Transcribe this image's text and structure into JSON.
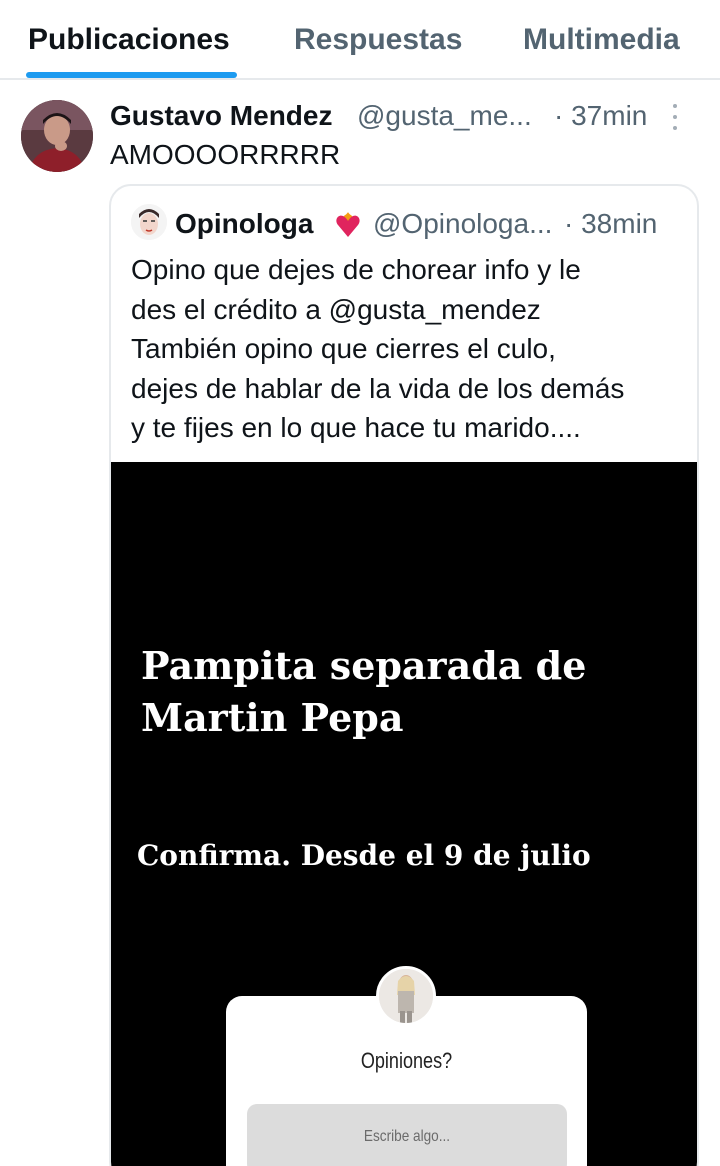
{
  "tabs": [
    {
      "label": "Publicaciones",
      "active": true
    },
    {
      "label": "Respuestas",
      "active": false
    },
    {
      "label": "Multimedia",
      "active": false
    }
  ],
  "colors": {
    "accent": "#1d9bf0",
    "text_primary": "#0f1419",
    "text_secondary": "#536471",
    "border": "#e6e9ec",
    "media_background": "#000000"
  },
  "tweet": {
    "author_name": "Gustavo Mendez",
    "author_handle": "@gusta_me...",
    "time": "· 37min",
    "text": "AMOOOORRRRR",
    "more_icon": "more-vertical-icon",
    "quoted": {
      "author_name": "Opinologa",
      "author_badge_icon": "heart-on-fire-icon",
      "author_handle": "@Opinologa...",
      "time": "· 38min",
      "text_lines": [
        "Opino que dejes de chorear info y le",
        "des el crédito a @gusta_mendez",
        "También opino que cierres el culo,",
        "dejes de hablar de la vida de los demás",
        "y te fijes en lo que hace tu marido...."
      ],
      "media": {
        "title_lines": [
          "Pampita separada de",
          "Martin Pepa"
        ],
        "subtitle": "Confirma. Desde el 9 de julio",
        "question_box": {
          "title": "Opiniones?",
          "placeholder": "Escribe algo..."
        }
      }
    }
  }
}
